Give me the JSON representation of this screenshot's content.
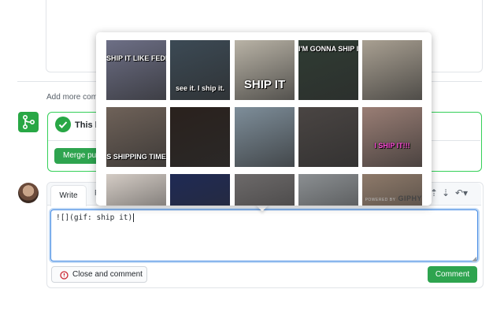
{
  "timeline": {
    "add_more_text": "Add more comm"
  },
  "merge": {
    "status_text": "This b",
    "merge_button_label": "Merge pul"
  },
  "composer": {
    "tab_write": "Write",
    "tab_preview": "P",
    "input_value": "![](gif: ship it)",
    "close_button_label": "Close and comment",
    "comment_button_label": "Comment"
  },
  "giphy": {
    "powered_by": "POWERED BY",
    "brand": "GIPHY",
    "gifs": [
      {
        "caption": "SHIP IT LIKE FEDEX",
        "bg": "#6d6f86"
      },
      {
        "caption": "see it. I ship it.",
        "bg": "#3c4a55"
      },
      {
        "caption": "SHIP IT",
        "bg": "#b9b3a6"
      },
      {
        "caption": "I'M GONNA SHIP IT",
        "bg": "#2f3c33"
      },
      {
        "caption": "",
        "bg": "#a9a092"
      },
      {
        "caption": "S SHIPPING TIME",
        "bg": "#6f6259"
      },
      {
        "caption": "",
        "bg": "#2a211d"
      },
      {
        "caption": "",
        "bg": "#7e8e9a"
      },
      {
        "caption": "",
        "bg": "#4a4543"
      },
      {
        "caption": "I SHIP IT!!!",
        "bg": "#9a7e75"
      },
      {
        "caption": "",
        "bg": "#d4ccc5"
      },
      {
        "caption": "",
        "bg": "#1f2a55"
      },
      {
        "caption": "",
        "bg": "#6d6a6a"
      },
      {
        "caption": "",
        "bg": "#8b8f92"
      },
      {
        "caption": "",
        "bg": "#8e7a6a"
      }
    ]
  },
  "colors": {
    "green": "#2ea44f",
    "focus_blue": "#0366d6",
    "close_icon_red": "#cb2431"
  },
  "icons": [
    "merge-icon",
    "check-icon",
    "close-issue-icon",
    "reply-icon",
    "sort-icon"
  ]
}
